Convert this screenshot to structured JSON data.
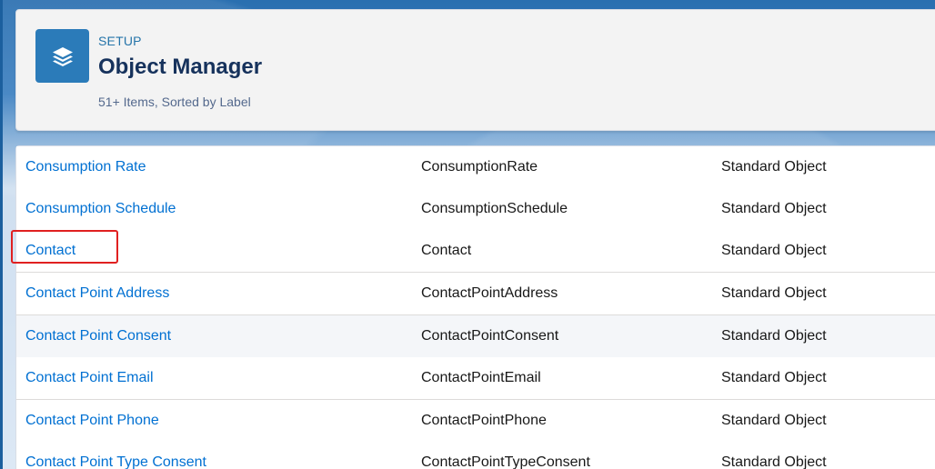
{
  "header": {
    "eyebrow": "SETUP",
    "title": "Object Manager",
    "meta": "51+ Items, Sorted by Label",
    "icon": "layers-icon",
    "icon_color": "#2b7bb9"
  },
  "table": {
    "rows": [
      {
        "label": "Consumption Rate",
        "api_name": "ConsumptionRate",
        "type": "Standard Object"
      },
      {
        "label": "Consumption Schedule",
        "api_name": "ConsumptionSchedule",
        "type": "Standard Object"
      },
      {
        "label": "Contact",
        "api_name": "Contact",
        "type": "Standard Object"
      },
      {
        "label": "Contact Point Address",
        "api_name": "ContactPointAddress",
        "type": "Standard Object"
      },
      {
        "label": "Contact Point Consent",
        "api_name": "ContactPointConsent",
        "type": "Standard Object"
      },
      {
        "label": "Contact Point Email",
        "api_name": "ContactPointEmail",
        "type": "Standard Object"
      },
      {
        "label": "Contact Point Phone",
        "api_name": "ContactPointPhone",
        "type": "Standard Object"
      },
      {
        "label": "Contact Point Type Consent",
        "api_name": "ContactPointTypeConsent",
        "type": "Standard Object"
      }
    ]
  },
  "colors": {
    "link": "#0070d2",
    "title": "#16325c",
    "highlight": "#e02020"
  }
}
